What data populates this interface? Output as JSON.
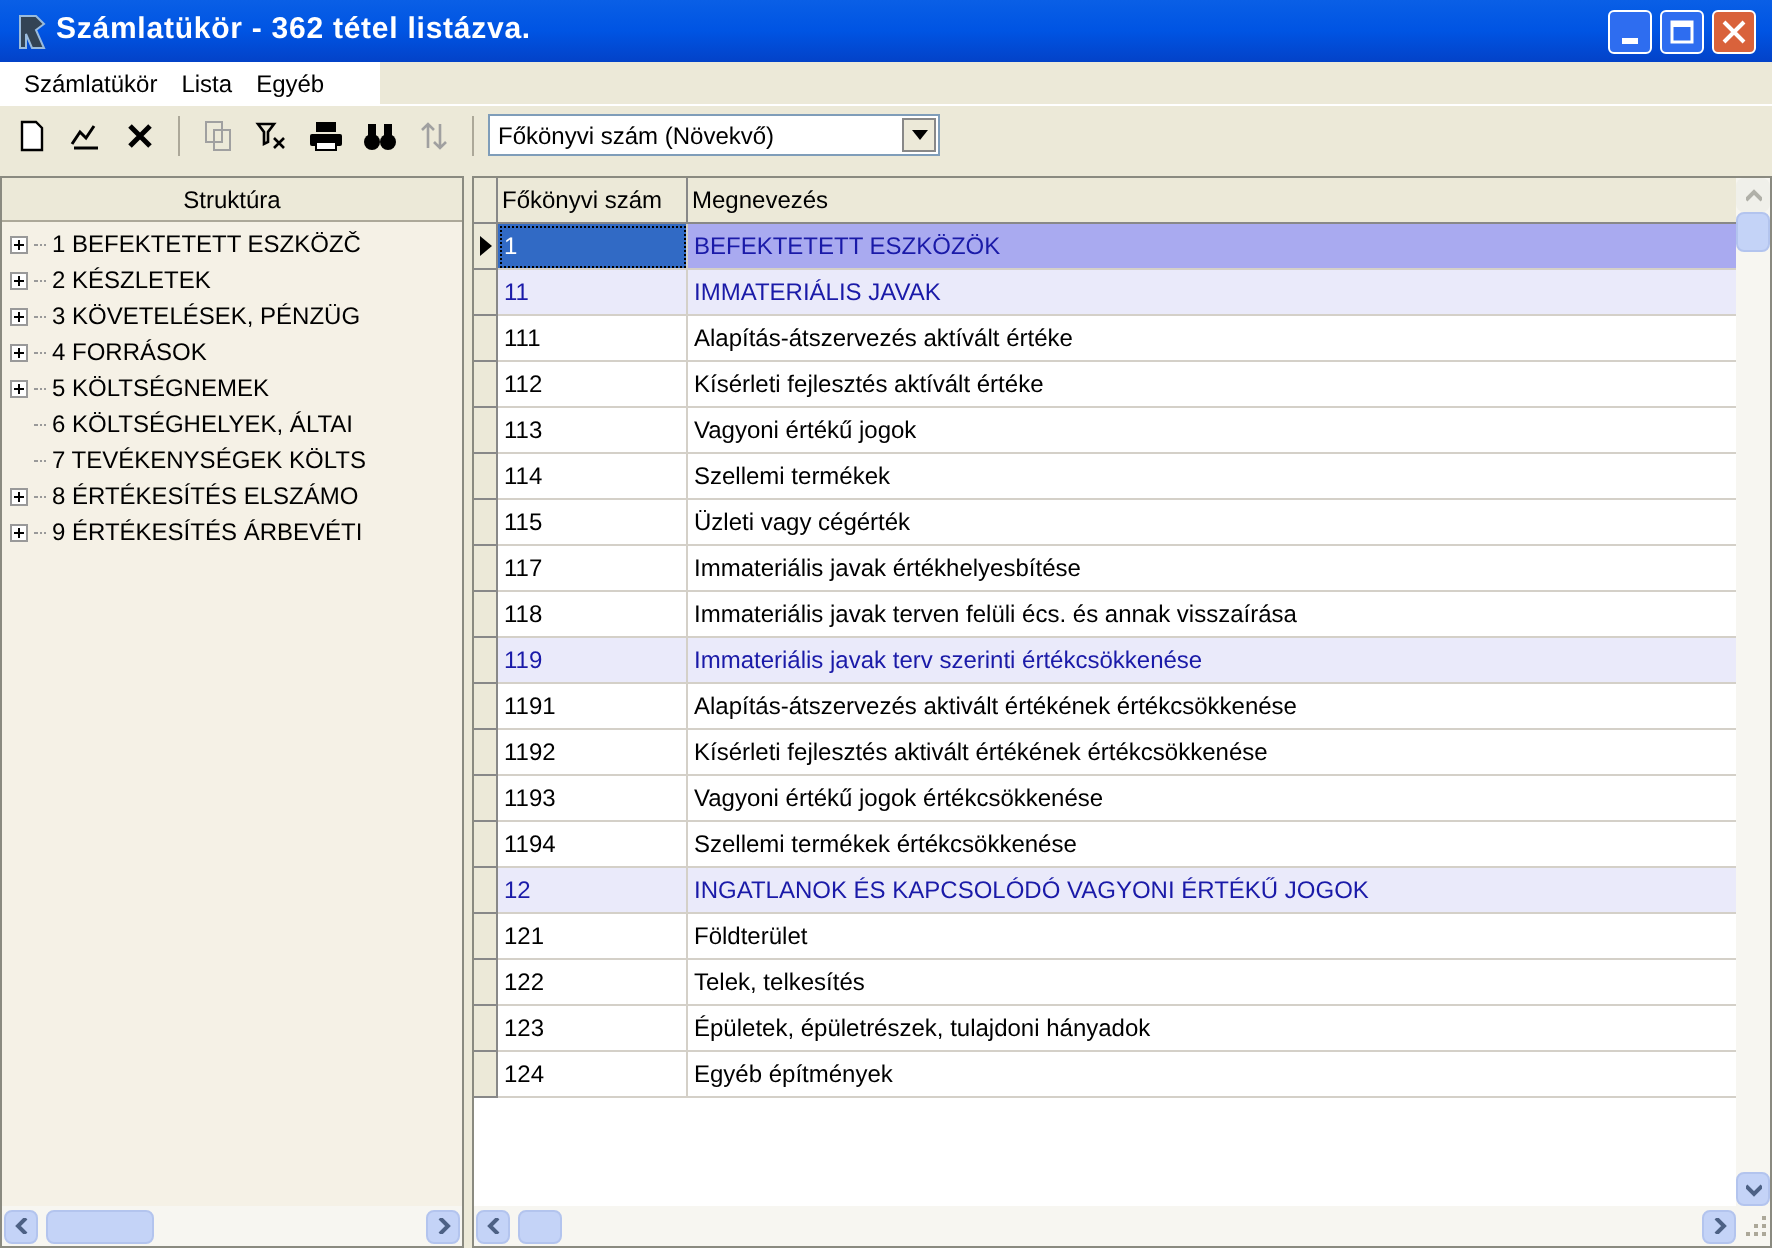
{
  "window": {
    "title": "Számlatükör - 362 tétel listázva."
  },
  "menu": [
    "Számlatükör",
    "Lista",
    "Egyéb"
  ],
  "toolbar": {
    "buttons": [
      {
        "kind": "new",
        "disabled": false
      },
      {
        "kind": "edit",
        "disabled": false
      },
      {
        "kind": "delete",
        "disabled": false
      },
      {
        "kind": "copy",
        "disabled": true
      },
      {
        "kind": "filter",
        "disabled": false
      },
      {
        "kind": "print",
        "disabled": false
      },
      {
        "kind": "find",
        "disabled": false
      },
      {
        "kind": "swap",
        "disabled": true
      }
    ],
    "sort": {
      "value": "Főkönyvi szám (Növekvő)"
    }
  },
  "tree": {
    "title": "Struktúra",
    "items": [
      {
        "label": "1 BEFEKTETETT ESZKÖZČ",
        "kind": "branch"
      },
      {
        "label": "2 KÉSZLETEK",
        "kind": "branch"
      },
      {
        "label": "3 KÖVETELÉSEK, PÉNZÜG",
        "kind": "branch"
      },
      {
        "label": "4 FORRÁSOK",
        "kind": "branch"
      },
      {
        "label": "5 KÖLTSÉGNEMEK",
        "kind": "branch"
      },
      {
        "label": "6 KÖLTSÉGHELYEK, ÁLTAI",
        "kind": "leaf"
      },
      {
        "label": "7 TEVÉKENYSÉGEK KÖLTS",
        "kind": "leaf"
      },
      {
        "label": "8 ÉRTÉKESÍTÉS ELSZÁMO",
        "kind": "branch"
      },
      {
        "label": "9 ÉRTÉKESÍTÉS ÁRBEVÉTI",
        "kind": "branch"
      }
    ]
  },
  "table": {
    "columns": [
      "Főkönyvi szám",
      "Megnevezés"
    ],
    "rows": [
      {
        "number": "1",
        "name": "BEFEKTETETT ESZKÖZÖK",
        "kind": "group",
        "selected": true
      },
      {
        "number": "11",
        "name": "IMMATERIÁLIS JAVAK",
        "kind": "group",
        "selected": false
      },
      {
        "number": "111",
        "name": "Alapítás-átszervezés aktívált értéke",
        "kind": "account",
        "selected": false
      },
      {
        "number": "112",
        "name": "Kísérleti fejlesztés aktívált értéke",
        "kind": "account",
        "selected": false
      },
      {
        "number": "113",
        "name": "Vagyoni értékű jogok",
        "kind": "account",
        "selected": false
      },
      {
        "number": "114",
        "name": "Szellemi termékek",
        "kind": "account",
        "selected": false
      },
      {
        "number": "115",
        "name": "Üzleti vagy cégérték",
        "kind": "account",
        "selected": false
      },
      {
        "number": "117",
        "name": "Immateriális javak értékhelyesbítése",
        "kind": "account",
        "selected": false
      },
      {
        "number": "118",
        "name": "Immateriális javak terven felüli écs. és annak visszaírása",
        "kind": "account",
        "selected": false
      },
      {
        "number": "119",
        "name": "Immateriális javak terv szerinti értékcsökkenése",
        "kind": "group",
        "selected": false
      },
      {
        "number": "1191",
        "name": "Alapítás-átszervezés aktivált értékének értékcsökkenése",
        "kind": "account",
        "selected": false
      },
      {
        "number": "1192",
        "name": "Kísérleti fejlesztés aktivált értékének értékcsökkenése",
        "kind": "account",
        "selected": false
      },
      {
        "number": "1193",
        "name": "Vagyoni értékű jogok értékcsökkenése",
        "kind": "account",
        "selected": false
      },
      {
        "number": "1194",
        "name": "Szellemi termékek értékcsökkenése",
        "kind": "account",
        "selected": false
      },
      {
        "number": "12",
        "name": "INGATLANOK ÉS KAPCSOLÓDÓ VAGYONI ÉRTÉKŰ JOGOK",
        "kind": "group",
        "selected": false
      },
      {
        "number": "121",
        "name": "Földterület",
        "kind": "account",
        "selected": false
      },
      {
        "number": "122",
        "name": "Telek, telkesítés",
        "kind": "account",
        "selected": false
      },
      {
        "number": "123",
        "name": "Épületek, épületrészek, tulajdoni hányadok",
        "kind": "account",
        "selected": false
      },
      {
        "number": "124",
        "name": "Egyéb építmények",
        "kind": "account",
        "selected": false
      }
    ]
  }
}
